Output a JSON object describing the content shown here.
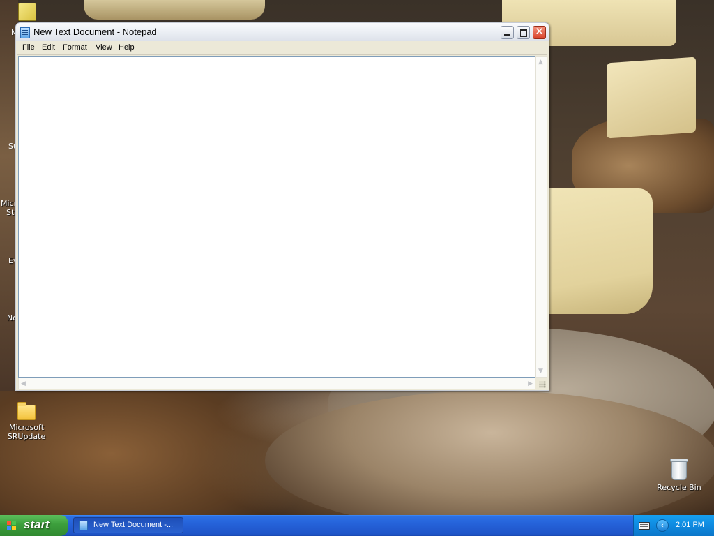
{
  "desktop": {
    "icons": [
      {
        "label": "Microsoft SRUpdate",
        "line1": "Microsoft",
        "line2": "SRUpdate",
        "icon": "folder-icon"
      },
      {
        "label": "Recycle Bin",
        "icon": "recycle-bin-icon"
      }
    ],
    "partial_labels": [
      "M",
      "Su",
      "Micro",
      "Stu",
      "Ev",
      "No"
    ]
  },
  "window": {
    "title": "New Text Document - Notepad",
    "icon": "notepad-icon",
    "menu": [
      "File",
      "Edit",
      "Format",
      "View",
      "Help"
    ],
    "content": "",
    "controls": {
      "minimize": "minimize-icon",
      "maximize": "maximize-icon",
      "close": "close-icon",
      "close_glyph": "✕"
    }
  },
  "taskbar": {
    "start_label": "start",
    "tasks": [
      {
        "label": "New Text Document -...",
        "icon": "notepad-icon"
      }
    ],
    "tray": {
      "icons": [
        "keyboard-icon",
        "chevron-left-icon"
      ],
      "chevron_glyph": "‹",
      "clock": "2:01 PM"
    }
  },
  "colors": {
    "taskbar_blue": "#245fd6",
    "start_green": "#3c9e3c",
    "close_red": "#d9432b"
  }
}
